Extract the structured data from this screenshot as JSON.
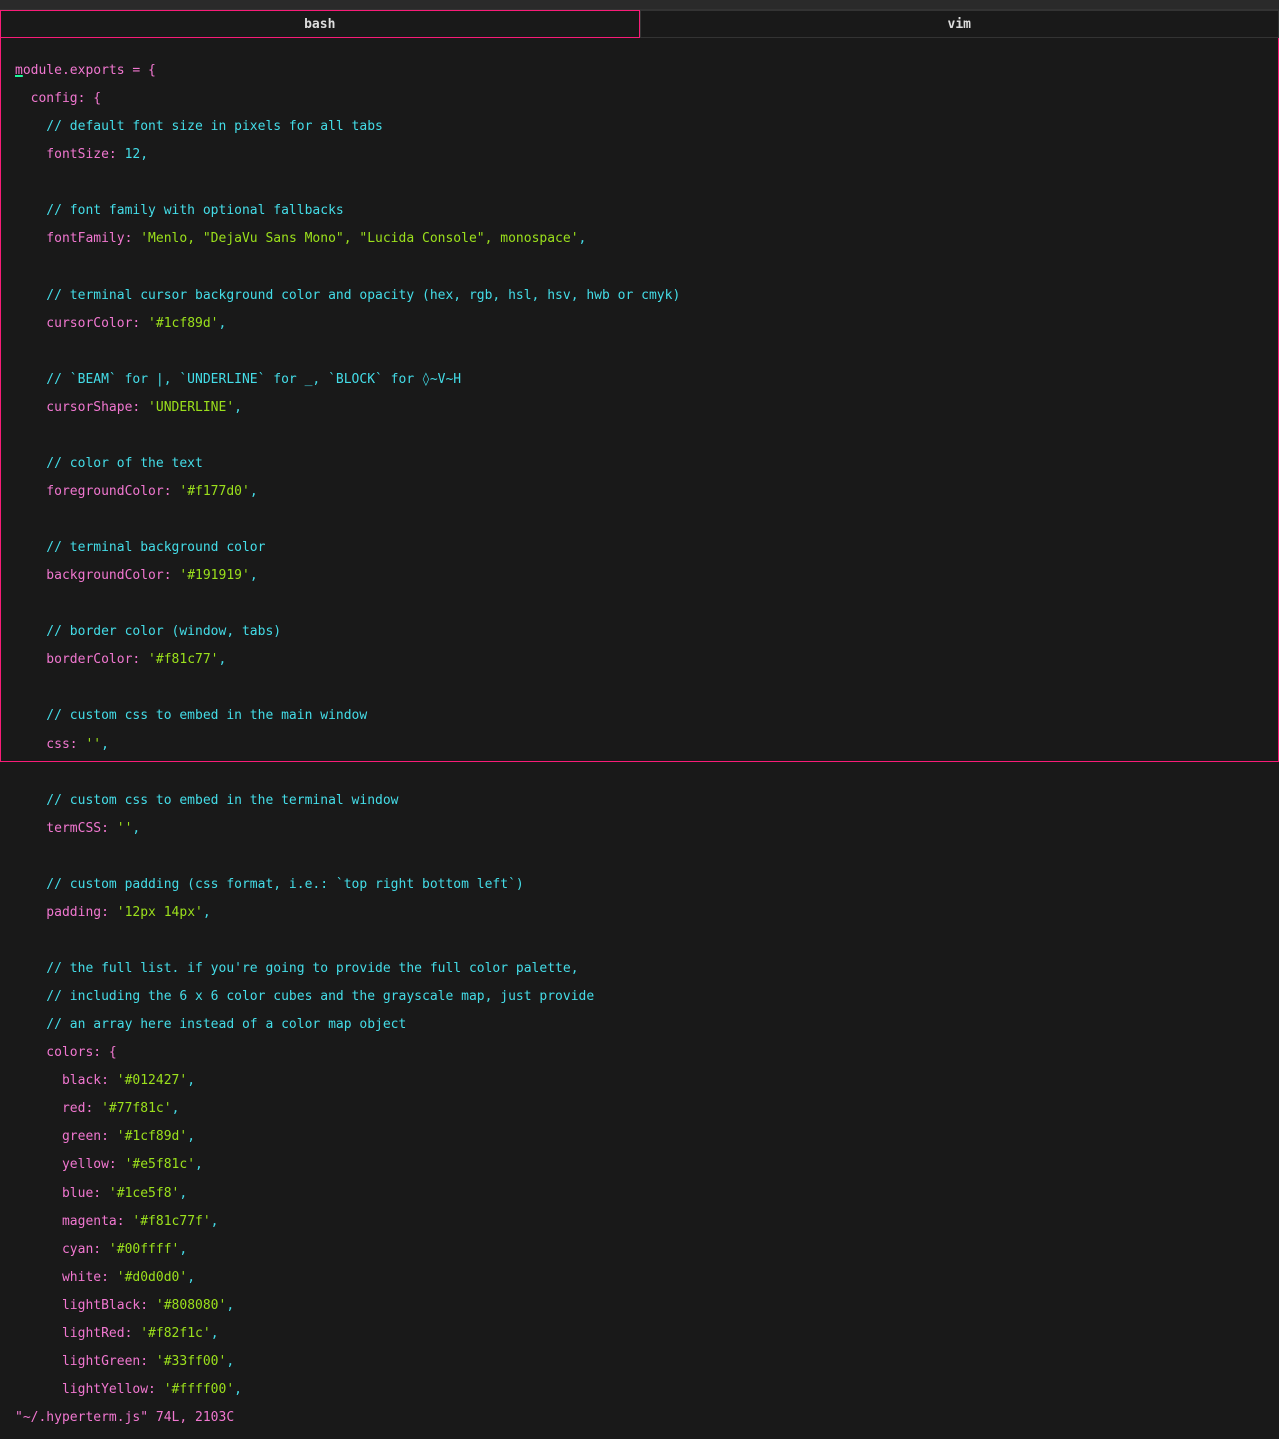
{
  "tabs": {
    "bash": "bash",
    "vim": "vim"
  },
  "code": {
    "l1a": "m",
    "l1b": "odule.exports = {",
    "l2a": "  config: {",
    "l3a": "    // default font size in pixels for all tabs",
    "l4k": "    fontSize:",
    "l4v": " 12,",
    "l5": "",
    "l6a": "    // font family with optional fallbacks",
    "l7k": "    fontFamily:",
    "l7v": " 'Menlo, \"DejaVu Sans Mono\", \"Lucida Console\", monospace'",
    "l7p": ",",
    "l8": "",
    "l9a": "    // terminal cursor background color and opacity (hex, rgb, hsl, hsv, hwb or cmyk)",
    "l10k": "    cursorColor:",
    "l10v": " '#1cf89d'",
    "l10p": ",",
    "l11": "",
    "l12a": "    // `BEAM` for |, `UNDERLINE` for _, `BLOCK` for ◊~V~H",
    "l13k": "    cursorShape:",
    "l13v": " 'UNDERLINE'",
    "l13p": ",",
    "l14": "",
    "l15a": "    // color of the text",
    "l16k": "    foregroundColor:",
    "l16v": " '#f177d0'",
    "l16p": ",",
    "l17": "",
    "l18a": "    // terminal background color",
    "l19k": "    backgroundColor:",
    "l19v": " '#191919'",
    "l19p": ",",
    "l20": "",
    "l21a": "    // border color (window, tabs)",
    "l22k": "    borderColor:",
    "l22v": " '#f81c77'",
    "l22p": ",",
    "l23": "",
    "l24a": "    // custom css to embed in the main window",
    "l25k": "    css:",
    "l25v": " ''",
    "l25p": ",",
    "l26": "",
    "l27a": "    // custom css to embed in the terminal window",
    "l28k": "    termCSS:",
    "l28v": " ''",
    "l28p": ",",
    "l29": "",
    "l30a": "    // custom padding (css format, i.e.: `top right bottom left`)",
    "l31k": "    padding:",
    "l31v": " '12px 14px'",
    "l31p": ",",
    "l32": "",
    "l33a": "    // the full list. if you're going to provide the full color palette,",
    "l34a": "    // including the 6 x 6 color cubes and the grayscale map, just provide",
    "l35a": "    // an array here instead of a color map object",
    "l36k": "    colors: {",
    "c1k": "      black:",
    "c1v": " '#012427'",
    "c1p": ",",
    "c2k": "      red:",
    "c2v": " '#77f81c'",
    "c2p": ",",
    "c3k": "      green:",
    "c3v": " '#1cf89d'",
    "c3p": ",",
    "c4k": "      yellow:",
    "c4v": " '#e5f81c'",
    "c4p": ",",
    "c5k": "      blue:",
    "c5v": " '#1ce5f8'",
    "c5p": ",",
    "c6k": "      magenta:",
    "c6v": " '#f81c77f'",
    "c6p": ",",
    "c7k": "      cyan:",
    "c7v": " '#00ffff'",
    "c7p": ",",
    "c8k": "      white:",
    "c8v": " '#d0d0d0'",
    "c8p": ",",
    "c9k": "      lightBlack:",
    "c9v": " '#808080'",
    "c9p": ",",
    "c10k": "      lightRed:",
    "c10v": " '#f82f1c'",
    "c10p": ",",
    "c11k": "      lightGreen:",
    "c11v": " '#33ff00'",
    "c11p": ",",
    "c12k": "      lightYellow:",
    "c12v": " '#ffff00'",
    "c12p": ","
  },
  "status": "\"~/.hyperterm.js\" 74L, 2103C"
}
